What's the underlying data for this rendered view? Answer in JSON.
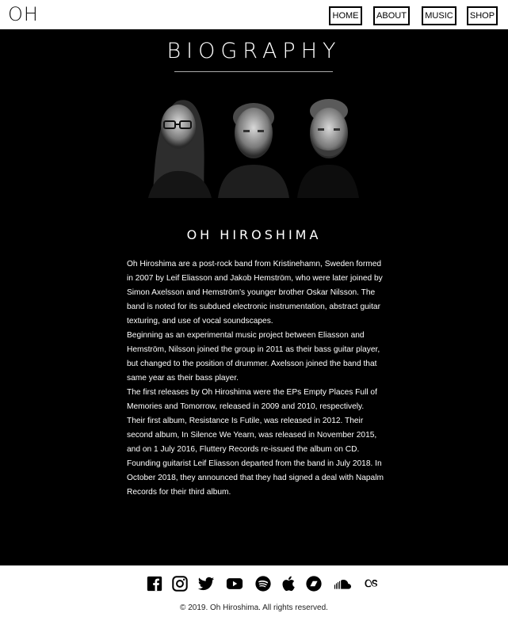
{
  "header": {
    "logo": "OH",
    "nav": [
      {
        "label": "HOME"
      },
      {
        "label": "ABOUT"
      },
      {
        "label": "MUSIC"
      },
      {
        "label": "SHOP"
      }
    ]
  },
  "main": {
    "title": "BIOGRAPHY",
    "band_name": "OH HIROSHIMA",
    "paragraphs": [
      "Oh Hiroshima are a post-rock band from Kristinehamn, Sweden formed in 2007 by Leif Eliasson and Jakob Hemström, who were later joined by Simon Axelsson and Hemström's younger brother Oskar Nilsson. The band is noted for its subdued electronic instrumentation, abstract guitar texturing, and use of vocal soundscapes.",
      "Beginning as an experimental music project between Eliasson and Hemström, Nilsson joined the group in 2011 as their bass guitar player, but changed to the position of drummer. Axelsson joined the band that same year as their bass player.",
      "The first releases by Oh Hiroshima were the EPs Empty Places Full of Memories and Tomorrow, released in 2009 and 2010, respectively.",
      "Their first album, Resistance Is Futile, was released in 2012. Their second album, In Silence We Yearn, was released in November 2015, and on 1 July 2016, Fluttery Records re-issued the album on CD.",
      "Founding guitarist Leif Eliasson departed from the band in July 2018. In October 2018, they announced that they had signed a deal with Napalm Records for their third album."
    ]
  },
  "footer": {
    "icons": [
      "facebook-icon",
      "instagram-icon",
      "twitter-icon",
      "youtube-icon",
      "spotify-icon",
      "apple-icon",
      "bandcamp-icon",
      "soundcloud-icon",
      "lastfm-icon"
    ],
    "copyright": "© 2019. Oh Hiroshima. All rights reserved."
  }
}
